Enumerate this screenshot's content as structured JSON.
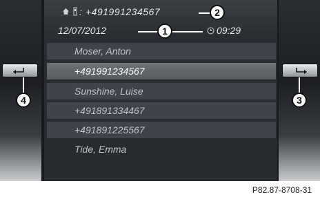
{
  "header": {
    "phone_number": "+491991234567",
    "date": "12/07/2012",
    "time": "09:29"
  },
  "entries": [
    {
      "label": "Moser, Anton"
    },
    {
      "label": "+491991234567"
    },
    {
      "label": "Sunshine, Luise"
    },
    {
      "label": "+491891334467"
    },
    {
      "label": "+491891225567"
    },
    {
      "label": "Tide, Emma"
    }
  ],
  "callouts": {
    "c1": "1",
    "c2": "2",
    "c3": "3",
    "c4": "4"
  },
  "icons": {
    "home": "house-icon",
    "signal": "phone-signal-icon",
    "clock": "clock-icon",
    "back": "back-arrow-icon",
    "forward": "forward-arrow-icon"
  },
  "caption": "P82.87-8708-31"
}
